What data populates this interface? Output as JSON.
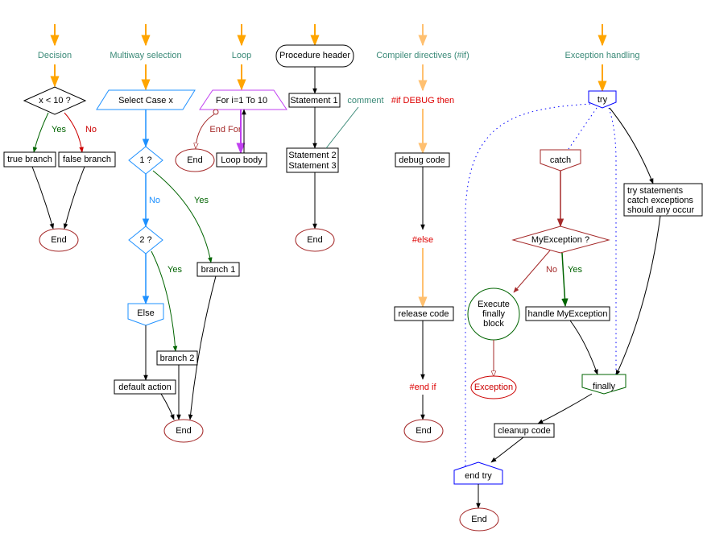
{
  "colors": {
    "arrow_orange": "#ffa500",
    "arrow_light_orange": "#ffc070",
    "header_text": "#3b8a78",
    "yes_green": "#006400",
    "no_red": "#cc0000",
    "multiway_blue": "#1e90ff",
    "loop_violet": "#c040f0",
    "exception_darkred": "#a52a2a",
    "try_blue": "#0000ff"
  },
  "decision": {
    "title": "Decision",
    "condition": "x < 10 ?",
    "yes": "Yes",
    "no": "No",
    "true_branch": "true branch",
    "false_branch": "false branch",
    "end": "End"
  },
  "multiway": {
    "title": "Multiway selection",
    "select": "Select Case x",
    "case1": "1 ?",
    "case2": "2 ?",
    "yes1": "Yes",
    "no1": "No",
    "yes2": "Yes",
    "branch1": "branch 1",
    "branch2": "branch 2",
    "else": "Else",
    "default": "default action",
    "end": "End"
  },
  "loop": {
    "title": "Loop",
    "header": "For i=1 To 10",
    "end_for": "End For",
    "end": "End",
    "body": "Loop body"
  },
  "procedure": {
    "header": "Procedure header",
    "statement1": "Statement 1",
    "statement2": "Statement 2",
    "statement3": "Statement 3",
    "comment": "comment",
    "end": "End"
  },
  "compiler": {
    "title": "Compiler directives (#if)",
    "if": "#if DEBUG then",
    "debug": "debug code",
    "else": "#else",
    "release": "release code",
    "endif": "#end if",
    "end": "End"
  },
  "exception": {
    "title": "Exception handling",
    "try": "try",
    "catch": "catch",
    "condition": "MyException ?",
    "no": "No",
    "yes": "Yes",
    "finally_block": [
      "Execute",
      "finally",
      "block"
    ],
    "exception": "Exception",
    "handle": "handle MyException",
    "try_statements": [
      "try statements",
      "catch exceptions",
      "should any occur"
    ],
    "finally": "finally",
    "cleanup": "cleanup code",
    "end_try": "end try",
    "end": "End"
  }
}
